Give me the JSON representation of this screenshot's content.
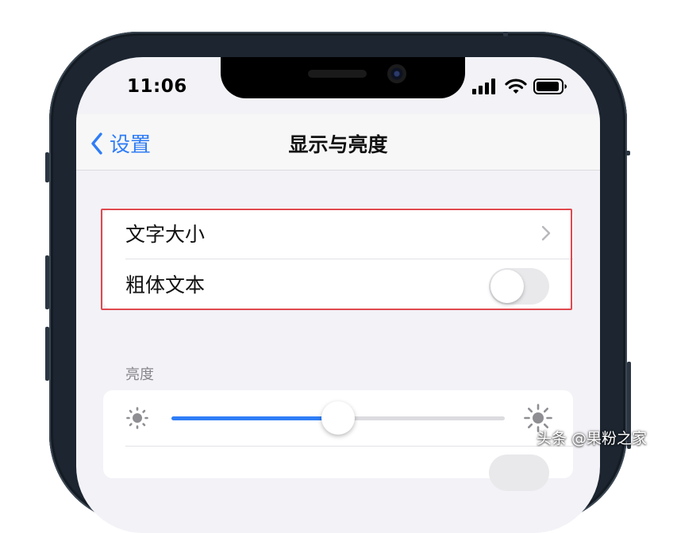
{
  "status_bar": {
    "time": "11:06"
  },
  "nav": {
    "back_label": "设置",
    "title": "显示与亮度"
  },
  "text_group": {
    "text_size_label": "文字大小",
    "bold_text_label": "粗体文本",
    "bold_text_on": false
  },
  "brightness": {
    "section_label": "亮度",
    "level": 0.5
  },
  "watermark": "头条 @果粉之家",
  "colors": {
    "accent": "#2f7df6",
    "highlight_box": "#e0494f",
    "background": "#f2f2f7"
  }
}
